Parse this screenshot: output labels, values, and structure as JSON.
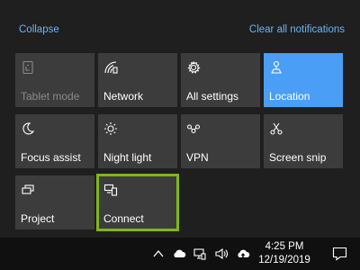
{
  "header": {
    "collapse_label": "Collapse",
    "clear_all_label": "Clear all notifications"
  },
  "tiles": [
    {
      "label": "Tablet mode",
      "icon": "tablet-mode-icon",
      "state": "disabled"
    },
    {
      "label": "Network",
      "icon": "network-icon",
      "state": "off"
    },
    {
      "label": "All settings",
      "icon": "gear-icon",
      "state": "off"
    },
    {
      "label": "Location",
      "icon": "location-icon",
      "state": "on"
    },
    {
      "label": "Focus assist",
      "icon": "moon-icon",
      "state": "off"
    },
    {
      "label": "Night light",
      "icon": "sun-icon",
      "state": "off"
    },
    {
      "label": "VPN",
      "icon": "vpn-icon",
      "state": "off"
    },
    {
      "label": "Screen snip",
      "icon": "screen-snip-icon",
      "state": "off"
    },
    {
      "label": "Project",
      "icon": "project-icon",
      "state": "off"
    },
    {
      "label": "Connect",
      "icon": "connect-icon",
      "state": "selected"
    }
  ],
  "taskbar": {
    "tray_icons": [
      "chevron-up-icon",
      "cloud-icon",
      "network-icon",
      "volume-icon",
      "onedrive-sync-icon"
    ],
    "time": "4:25 PM",
    "date": "12/19/2019"
  },
  "colors": {
    "accent": "#4a9ef6",
    "selection_border": "#7fb815",
    "link": "#6db3f2",
    "tile_bg": "#3c3c3c",
    "panel_bg": "#1f1f1f"
  }
}
